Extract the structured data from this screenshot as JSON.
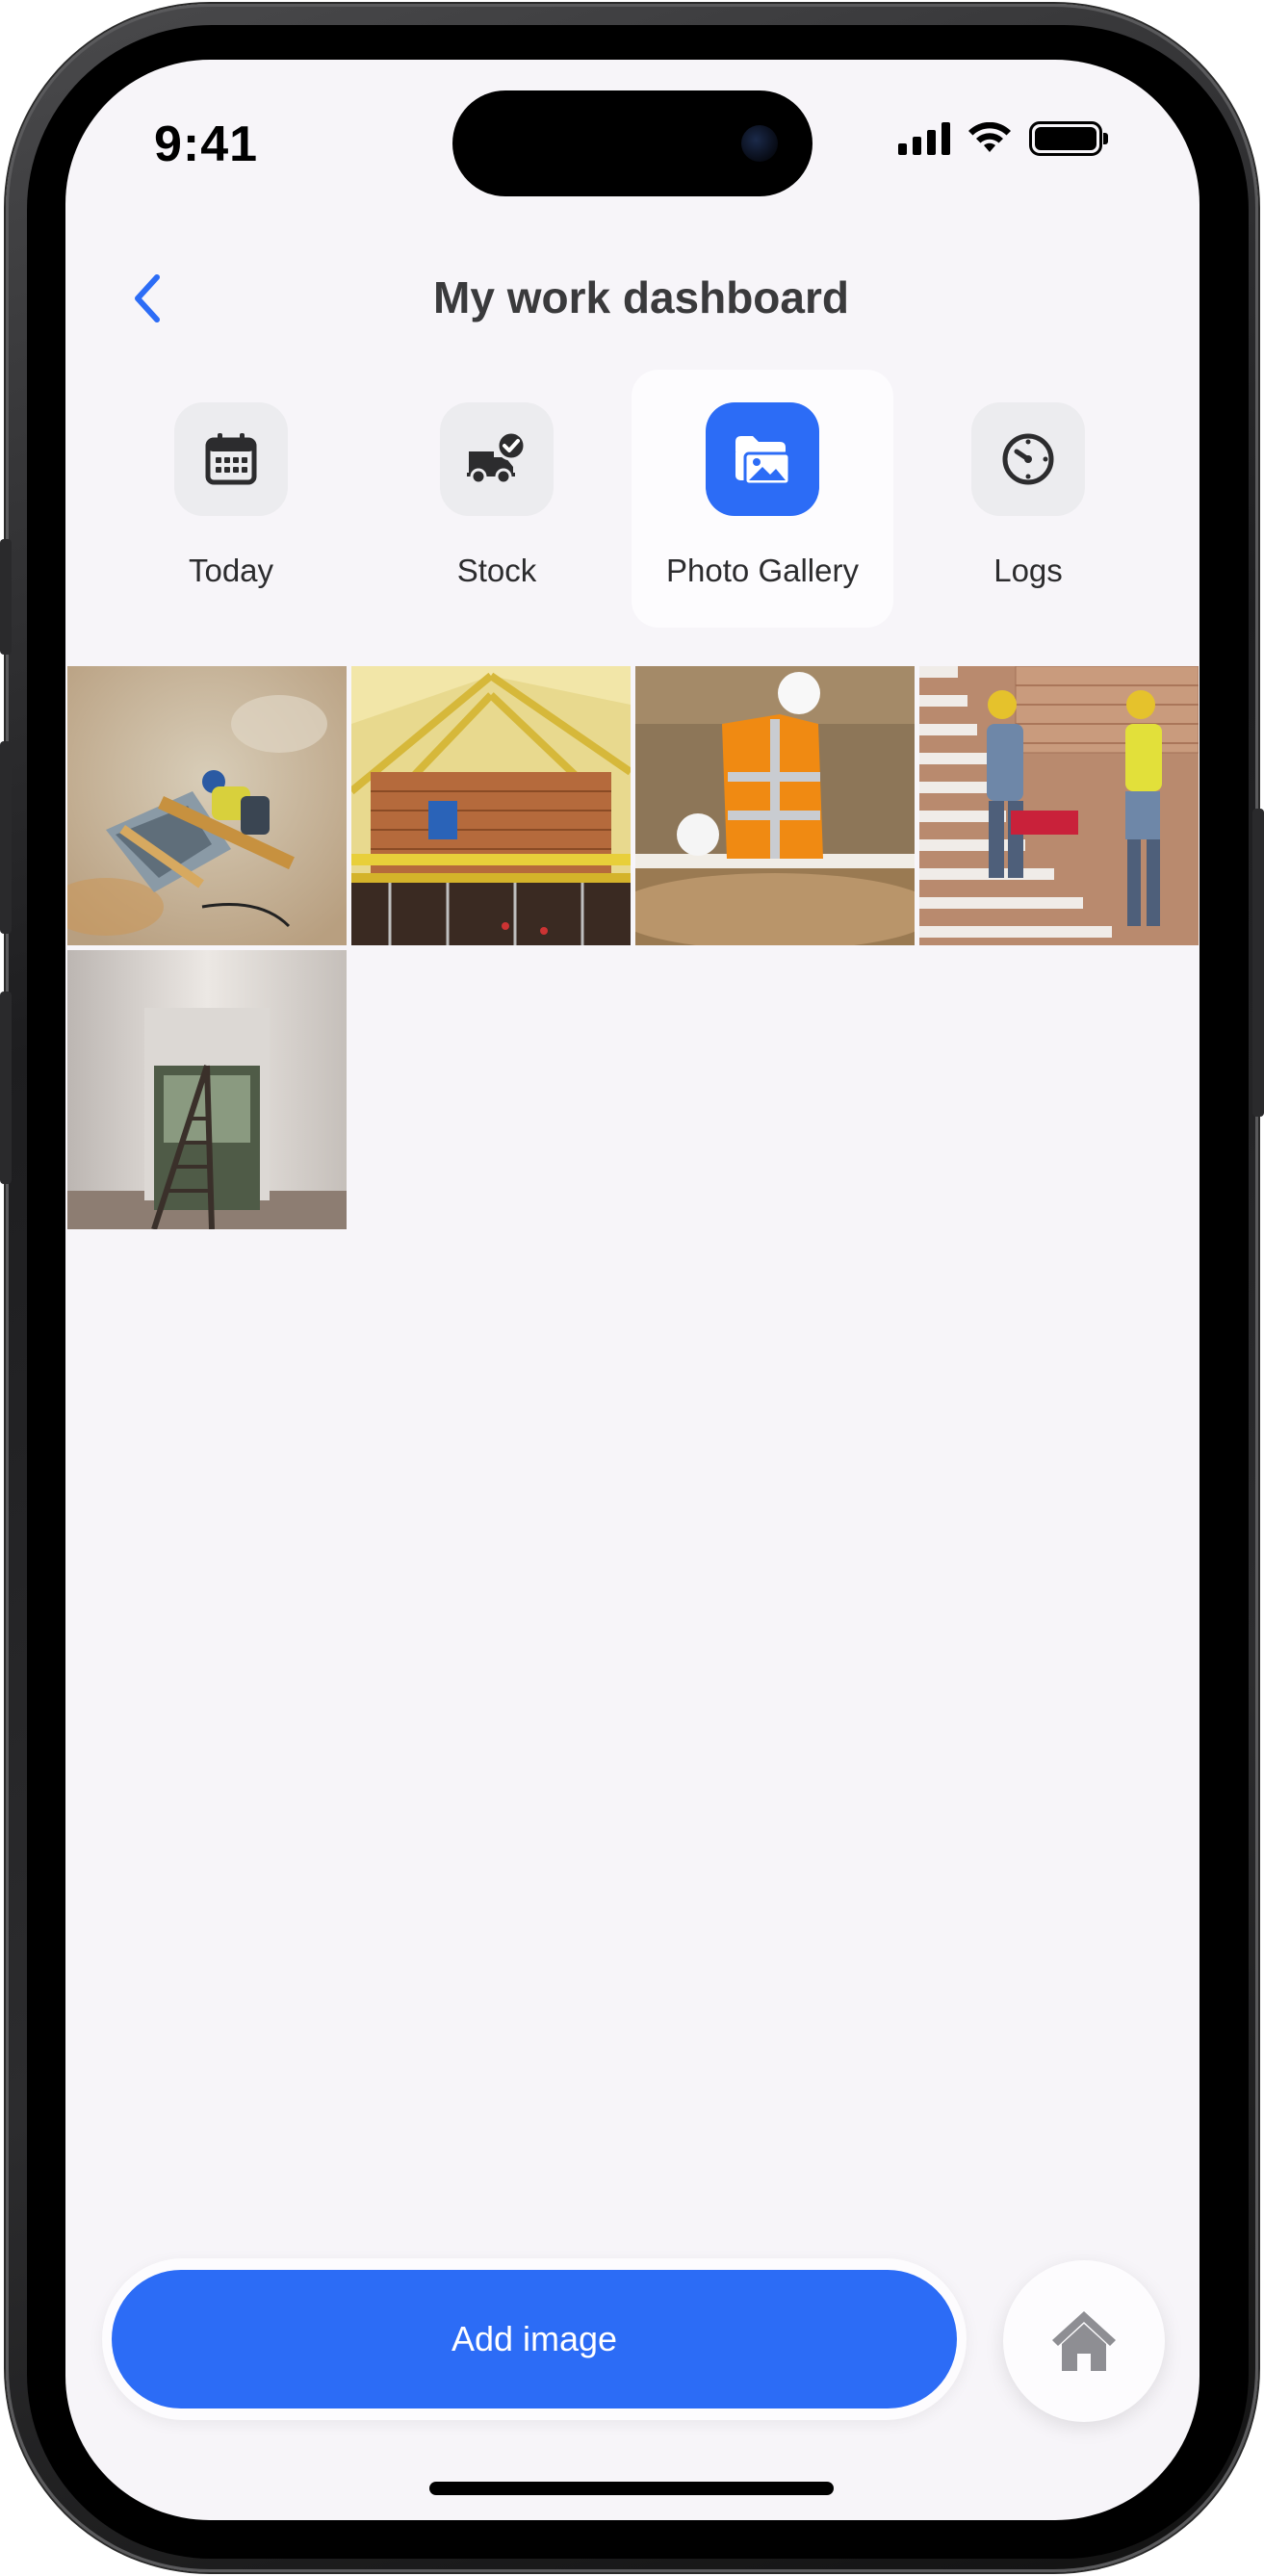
{
  "status_bar": {
    "time": "9:41",
    "icons": [
      "signal-icon",
      "wifi-icon",
      "battery-icon"
    ]
  },
  "header": {
    "back_icon": "chevron-left-icon",
    "title": "My work dashboard"
  },
  "tabs": [
    {
      "label": "Today",
      "icon": "calendar-icon",
      "active": false
    },
    {
      "label": "Stock",
      "icon": "delivery-truck-check-icon",
      "active": false
    },
    {
      "label": "Photo Gallery",
      "icon": "photo-folder-icon",
      "active": true
    },
    {
      "label": "Logs",
      "icon": "clock-icon",
      "active": false
    }
  ],
  "gallery": {
    "photos": [
      {
        "subject": "worker-cutting-wood-on-table-saw"
      },
      {
        "subject": "timber-roof-frame-with-scaffolding"
      },
      {
        "subject": "worker-in-hi-vis-vest-at-trench"
      },
      {
        "subject": "two-workers-with-hard-hats-on-stairs"
      },
      {
        "subject": "ladder-in-interior-room"
      }
    ]
  },
  "actions": {
    "add_image_label": "Add image",
    "home_icon": "home-icon"
  },
  "colors": {
    "accent": "#2c6cf6",
    "background": "#f7f5f9",
    "title_text": "#3a3a3c",
    "tab_icon_bg": "#ececef"
  }
}
